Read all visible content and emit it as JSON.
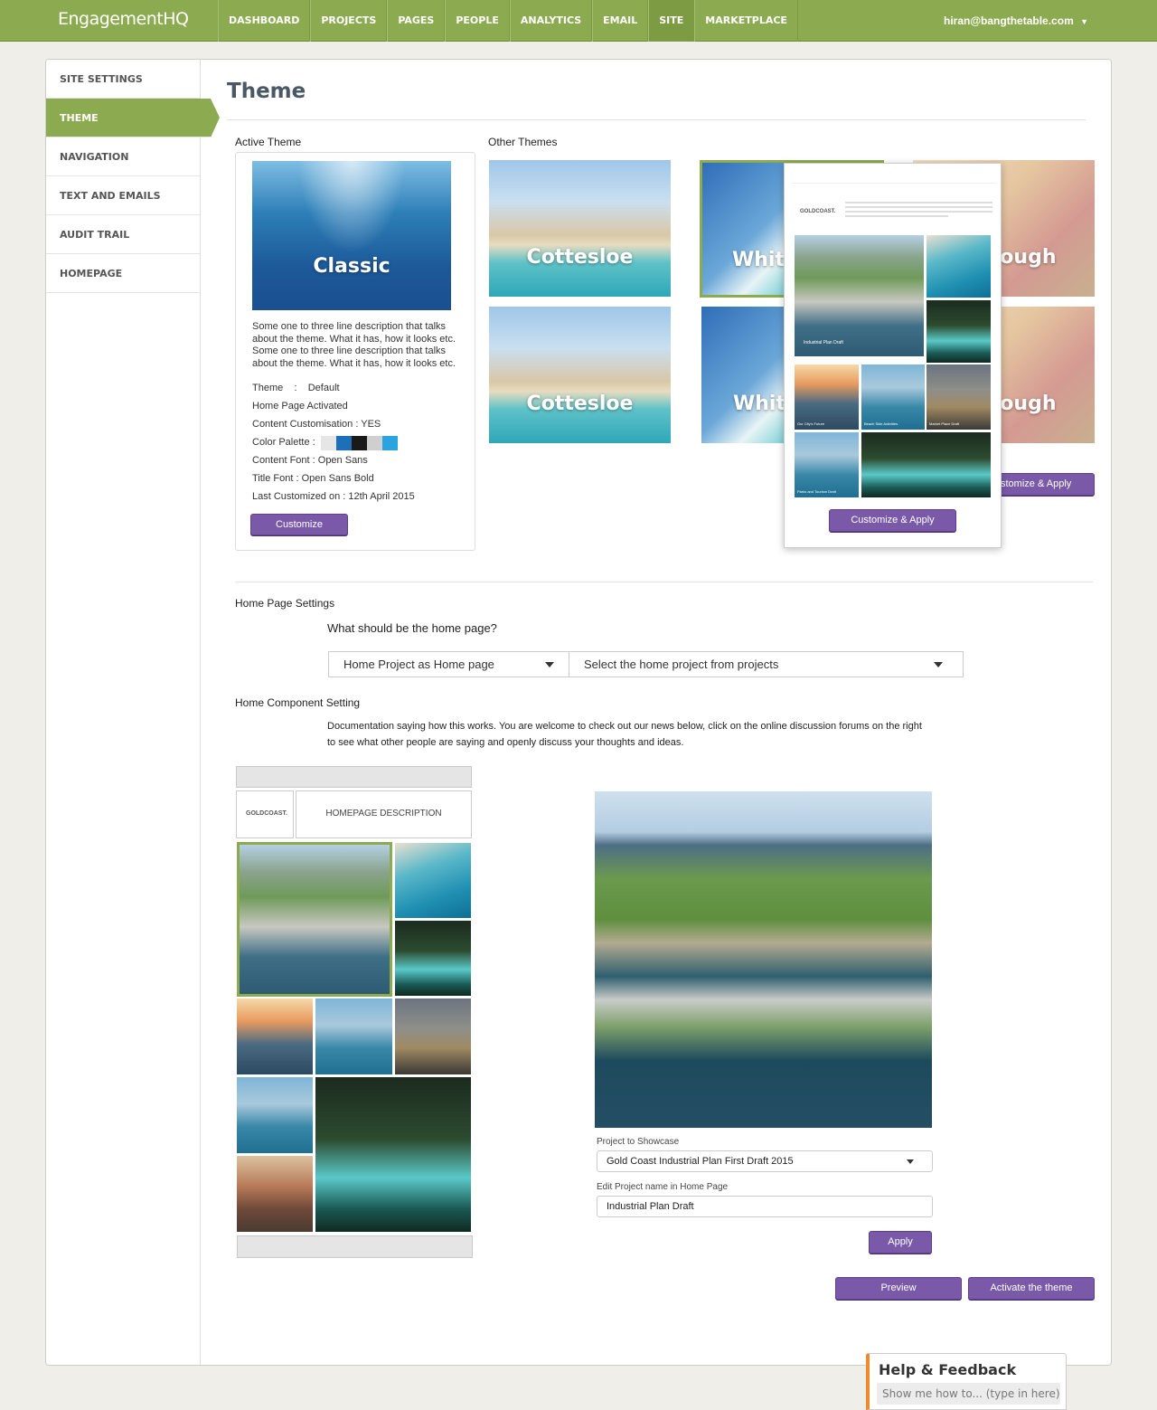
{
  "app": {
    "logo": "EngagementHQ",
    "user": "hiran@bangthetable.com"
  },
  "nav": [
    "DASHBOARD",
    "PROJECTS",
    "PAGES",
    "PEOPLE",
    "ANALYTICS",
    "EMAIL",
    "SITE",
    "MARKETPLACE"
  ],
  "nav_active": "SITE",
  "sidebar": [
    "SITE SETTINGS",
    "THEME",
    "NAVIGATION",
    "TEXT AND EMAILS",
    "AUDIT TRAIL",
    "HOMEPAGE"
  ],
  "sidebar_active": "THEME",
  "page_title": "Theme",
  "active_theme": {
    "heading": "Active Theme",
    "name": "Classic",
    "description": "Some one to three line description that talks about the theme. What it has, how it looks etc. Some one to three line description that talks about the theme. What it has, how it looks etc.",
    "theme_line": "Theme    :    Default",
    "home_page": "Home Page Activated",
    "content_customisation": "Content Customisation : YES",
    "palette_label": "Color Palette :",
    "palette": [
      "#e6e6e6",
      "#1d6fb8",
      "#1a1a1a",
      "#cfcfcf",
      "#2aa3de"
    ],
    "content_font": "Content Font : Open Sans",
    "title_font": "Title Font : Open Sans Bold",
    "last_customized": "Last Customized on :  12th April 2015",
    "customize_button": "Customize"
  },
  "other_themes": {
    "heading": "Other Themes",
    "names": [
      "Cottesloe",
      "Whitehaven",
      "Scarborough"
    ],
    "apply_button": "Customize & Apply",
    "apply_button_partial": "stomize & Apply"
  },
  "preview_popup": {
    "logo": "GOLDCOAST.",
    "tiles": [
      "Industrial Plan Draft",
      "Our City's Future",
      "Beach Side Activities",
      "Market Place Draft",
      "Parks and Tourism Draft"
    ],
    "button": "Customize & Apply"
  },
  "home_page_settings": {
    "heading": "Home Page Settings",
    "question": "What should be the home page?",
    "select_type": "Home Project as Home page",
    "select_project": "Select the home project from projects"
  },
  "home_component": {
    "heading": "Home Component Setting",
    "documentation": "Documentation saying how this works. You are welcome to check out our news below, click on the online discussion forums on the right to see what other people are saying and openly discuss your thoughts and ideas.",
    "logo": "GOLDCOAST.",
    "homepage_description": "HOMEPAGE DESCRIPTION"
  },
  "showcase": {
    "project_label": "Project to Showcase",
    "project_value": "Gold Coast Industrial Plan First Draft 2015",
    "name_label": "Edit Project name in Home Page",
    "name_value": "Industrial Plan Draft",
    "apply_button": "Apply"
  },
  "footer_buttons": {
    "preview": "Preview",
    "activate": "Activate the theme"
  },
  "help": {
    "title": "Help & Feedback",
    "placeholder": "Show me how to... (type in here)"
  }
}
